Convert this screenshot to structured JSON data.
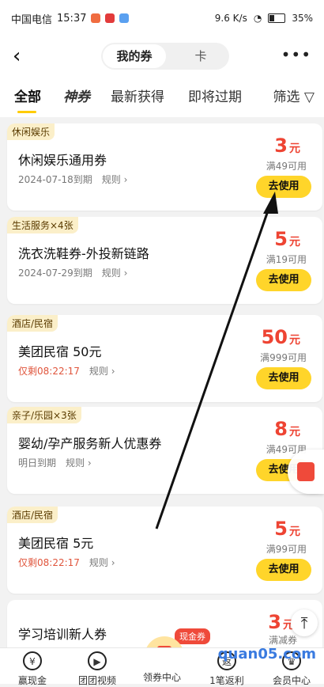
{
  "status": {
    "carrier": "中国电信",
    "time": "15:37",
    "network": "9.6 K/s",
    "battery": "35%"
  },
  "topbar": {
    "tab_active": "我的券",
    "tab_other": "卡",
    "more": "•••"
  },
  "tabs": [
    "全部",
    "神券",
    "最新获得",
    "即将过期"
  ],
  "filter": "筛选",
  "cards": [
    {
      "tag": "休闲娱乐",
      "title": "休闲娱乐通用券",
      "expiry": "2024-07-18到期",
      "rule": "规则",
      "amount": "3",
      "unit": "元",
      "cond": "满49可用",
      "btn": "去使用"
    },
    {
      "tag": "生活服务×4张",
      "title": "洗衣洗鞋券-外投新链路",
      "expiry": "2024-07-29到期",
      "rule": "规则",
      "amount": "5",
      "unit": "元",
      "cond": "满19可用",
      "btn": "去使用"
    },
    {
      "tag": "酒店/民宿",
      "title": "美团民宿 50元",
      "expiry": "仅剩08:22:17",
      "rule": "规则",
      "amount": "50",
      "unit": "元",
      "cond": "满999可用",
      "btn": "去使用"
    },
    {
      "tag": "亲子/乐园×3张",
      "title": "婴幼/孕产服务新人优惠券",
      "expiry": "明日到期",
      "rule": "规则",
      "amount": "8",
      "unit": "元",
      "cond": "满49可用",
      "btn": "去使用"
    },
    {
      "tag": "酒店/民宿",
      "title": "美团民宿 5元",
      "expiry": "仅剩08:22:17",
      "rule": "规则",
      "amount": "5",
      "unit": "元",
      "cond": "满99可用",
      "btn": "去使用"
    },
    {
      "tag": "",
      "title": "学习培训新人券",
      "expiry": "",
      "rule": "",
      "amount": "3",
      "unit": "元",
      "cond": "满减券",
      "btn": ""
    }
  ],
  "bottom_nav": [
    {
      "label": "赢现金",
      "icon": "¥"
    },
    {
      "label": "团团视频",
      "icon": "▶"
    },
    {
      "label": "领券中心",
      "icon": ""
    },
    {
      "label": "1笔返利",
      "icon": "返"
    },
    {
      "label": "会员中心",
      "icon": "♛"
    }
  ],
  "center_badge": "现金券",
  "watermark": "quan05.com"
}
